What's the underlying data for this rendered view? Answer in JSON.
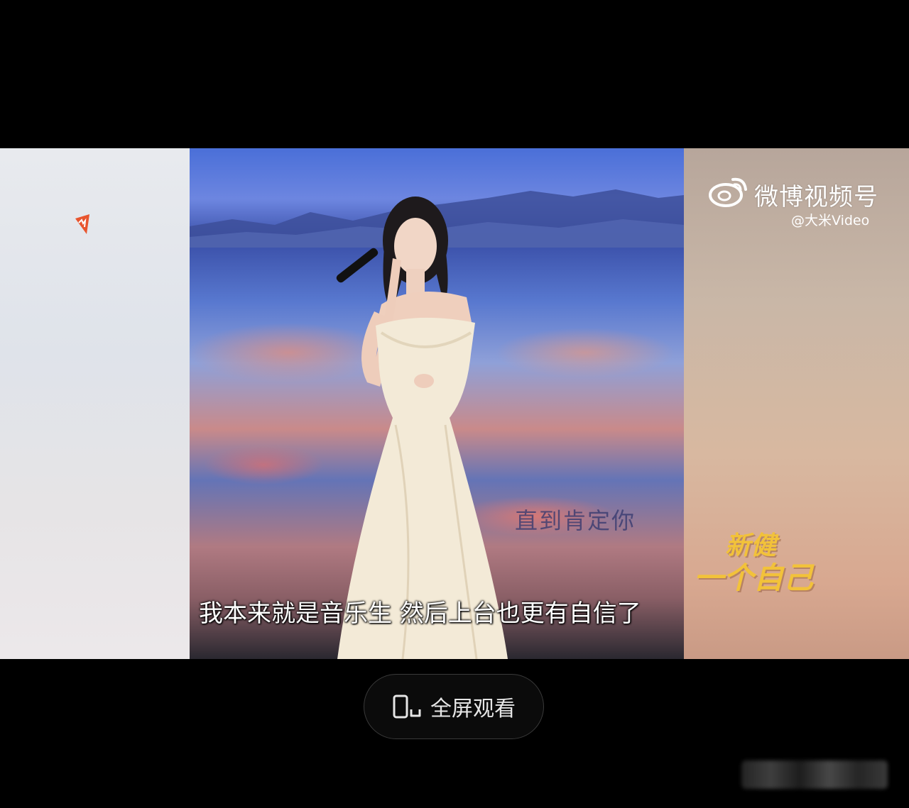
{
  "player": {
    "subtitle": "我本来就是音乐生 然后上台也更有自信了",
    "stage_screen_text": "直到肯定你",
    "watermark": {
      "title": "微博视频号",
      "handle": "@大米Video"
    },
    "promo": {
      "line1": "新健",
      "line2": "一个自己"
    }
  },
  "controls": {
    "fullscreen_label": "全屏观看"
  },
  "colors": {
    "background": "#000000",
    "promo_text": "#f2c23a",
    "button_border": "#3a3a3a"
  }
}
